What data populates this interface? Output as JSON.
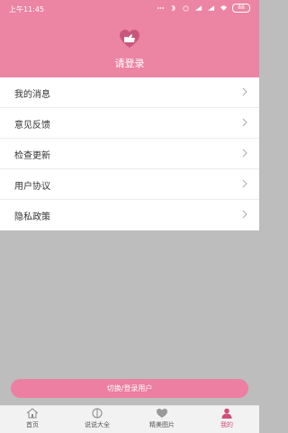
{
  "status": {
    "time": "上午11:45",
    "battery": "88"
  },
  "header": {
    "login_text": "请登录"
  },
  "menu": {
    "items": [
      {
        "label": "我的消息"
      },
      {
        "label": "意见反馈"
      },
      {
        "label": "检查更新"
      },
      {
        "label": "用户协议"
      },
      {
        "label": "隐私政策"
      }
    ]
  },
  "switch_button": {
    "label": "切换/登录用户"
  },
  "tabs": [
    {
      "label": "首页"
    },
    {
      "label": "说说大全"
    },
    {
      "label": "精美图片"
    },
    {
      "label": "我的"
    }
  ],
  "colors": {
    "accent": "#ec84a4",
    "active_tab": "#d44c7c"
  }
}
